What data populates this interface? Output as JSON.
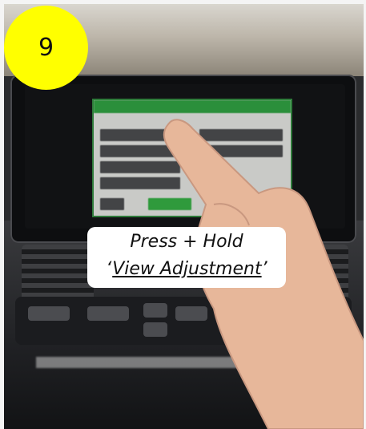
{
  "step": {
    "number": "9",
    "badge_color": "#ffff00"
  },
  "caption": {
    "line1": "Press + Hold",
    "line2_open": "‘",
    "line2_link": "View Adjustment",
    "line2_close": "’"
  },
  "photo": {
    "description_icon": "hand-pointing-icon",
    "screen_dialog_color": "#2b8f3b"
  }
}
